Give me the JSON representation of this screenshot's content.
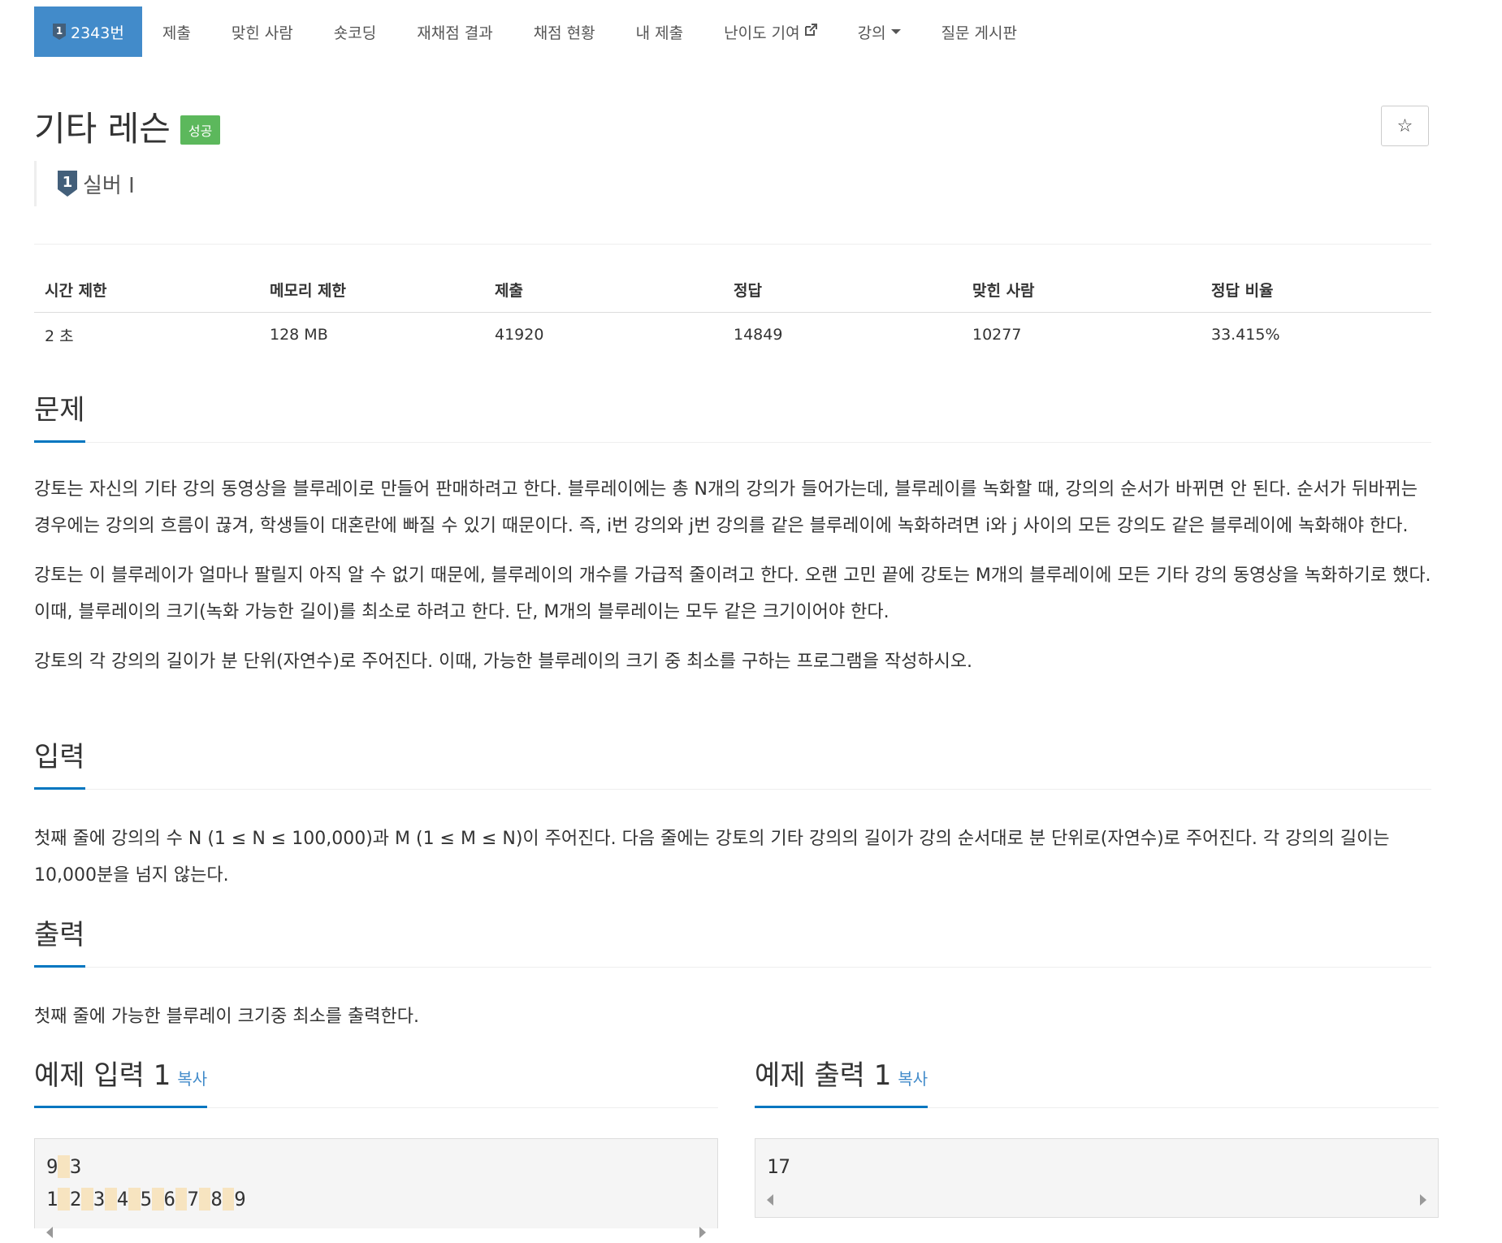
{
  "nav": {
    "problem_number": "2343번",
    "items": [
      "제출",
      "맞힌 사람",
      "숏코딩",
      "재채점 결과",
      "채점 현황",
      "내 제출",
      "난이도 기여",
      "강의",
      "질문 게시판"
    ],
    "tier_badge_number": "1"
  },
  "problem": {
    "title": "기타 레슨",
    "result_badge": "성공",
    "star_label": "☆",
    "tier_number": "1",
    "tier_label": "실버 I"
  },
  "info": {
    "headers": [
      "시간 제한",
      "메모리 제한",
      "제출",
      "정답",
      "맞힌 사람",
      "정답 비율"
    ],
    "values": [
      "2 초",
      "128 MB",
      "41920",
      "14849",
      "10277",
      "33.415%"
    ]
  },
  "sections": {
    "problem_heading": "문제",
    "problem_paragraphs": [
      "강토는 자신의 기타 강의 동영상을 블루레이로 만들어 판매하려고 한다. 블루레이에는 총 N개의 강의가 들어가는데, 블루레이를 녹화할 때, 강의의 순서가 바뀌면 안 된다. 순서가 뒤바뀌는 경우에는 강의의 흐름이 끊겨, 학생들이 대혼란에 빠질 수 있기 때문이다. 즉, i번 강의와 j번 강의를 같은 블루레이에 녹화하려면 i와 j 사이의 모든 강의도 같은 블루레이에 녹화해야 한다.",
      "강토는 이 블루레이가 얼마나 팔릴지 아직 알 수 없기 때문에, 블루레이의 개수를 가급적 줄이려고 한다. 오랜 고민 끝에 강토는 M개의 블루레이에 모든 기타 강의 동영상을 녹화하기로 했다. 이때, 블루레이의 크기(녹화 가능한 길이)를 최소로 하려고 한다. 단, M개의 블루레이는 모두 같은 크기이어야 한다.",
      "강토의 각 강의의 길이가 분 단위(자연수)로 주어진다. 이때, 가능한 블루레이의 크기 중 최소를 구하는 프로그램을 작성하시오."
    ],
    "input_heading": "입력",
    "input_text": "첫째 줄에 강의의 수 N (1 ≤ N ≤ 100,000)과 M (1 ≤ M ≤ N)이 주어진다. 다음 줄에는 강토의 기타 강의의 길이가 강의 순서대로 분 단위로(자연수)로 주어진다. 각 강의의 길이는 10,000분을 넘지 않는다.",
    "output_heading": "출력",
    "output_text": "첫째 줄에 가능한 블루레이 크기중 최소를 출력한다."
  },
  "samples": {
    "input_heading": "예제 입력 1",
    "output_heading": "예제 출력 1",
    "copy_label": "복사",
    "input_lines": [
      [
        "9",
        "3"
      ],
      [
        "1",
        "2",
        "3",
        "4",
        "5",
        "6",
        "7",
        "8",
        "9"
      ]
    ],
    "output_text": "17"
  },
  "colors": {
    "nav_active": "#428bca",
    "success_badge": "#5cb85c",
    "heading_underline": "#0076c0",
    "link": "#428bca"
  }
}
